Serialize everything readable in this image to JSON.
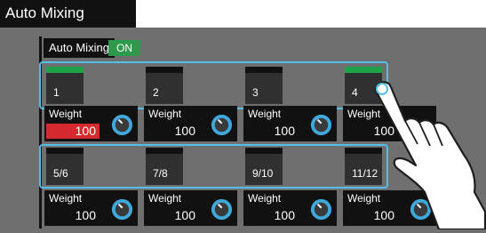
{
  "title": "Auto Mixing",
  "auto_mixing": {
    "label": "Auto Mixing",
    "state": "ON"
  },
  "channels": [
    {
      "label": "1",
      "on": true
    },
    {
      "label": "2",
      "on": false
    },
    {
      "label": "3",
      "on": false
    },
    {
      "label": "4",
      "on": true
    },
    {
      "label": "5/6",
      "on": false
    },
    {
      "label": "7/8",
      "on": false
    },
    {
      "label": "9/10",
      "on": false
    },
    {
      "label": "11/12",
      "on": false
    }
  ],
  "weights": [
    {
      "label": "Weight",
      "value": "100",
      "highlight": true
    },
    {
      "label": "Weight",
      "value": "100",
      "highlight": false
    },
    {
      "label": "Weight",
      "value": "100",
      "highlight": false
    },
    {
      "label": "Weight",
      "value": "100",
      "highlight": false
    },
    {
      "label": "Weight",
      "value": "100",
      "highlight": false
    },
    {
      "label": "Weight",
      "value": "100",
      "highlight": false
    },
    {
      "label": "Weight",
      "value": "100",
      "highlight": false
    },
    {
      "label": "Weight",
      "value": "100",
      "highlight": false
    }
  ],
  "colors": {
    "accent": "#55bde6",
    "on": "#1fa34a",
    "alert": "#d42a2f"
  }
}
